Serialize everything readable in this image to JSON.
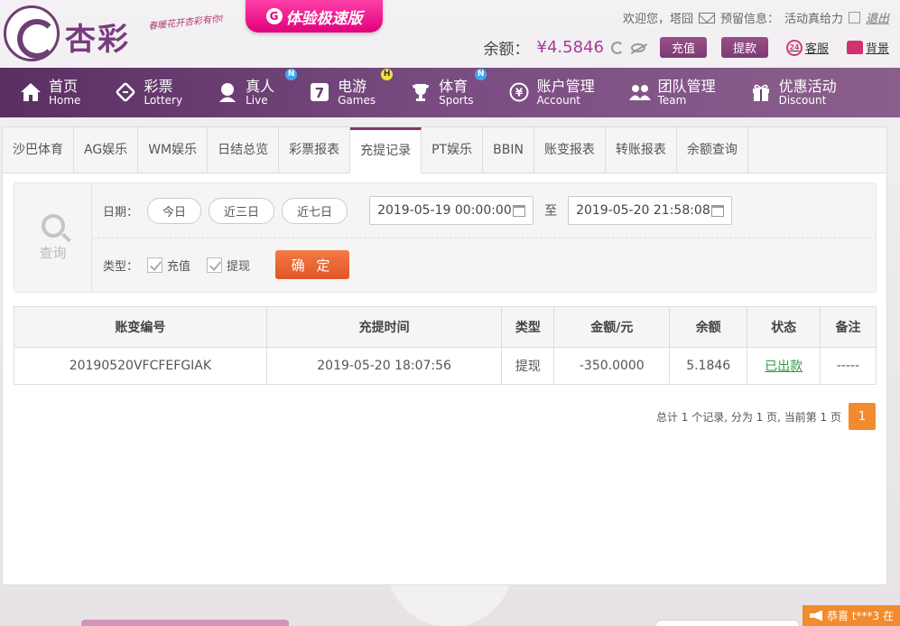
{
  "header": {
    "logo_name": "杏彩",
    "slogan": "春暖花开杏彩有你!",
    "speed_badge": "体验极速版",
    "welcome": "欢迎您，塔囧",
    "messages": "预留信息：",
    "activity": "活动真给力",
    "logout": "退出",
    "balance_label": "余额：",
    "balance_value": "¥4.5846",
    "deposit_btn": "充值",
    "withdraw_btn": "提款",
    "service": "客服",
    "service_badge": "24",
    "background": "背景"
  },
  "nav": {
    "items": [
      {
        "zh": "首页",
        "en": "Home",
        "icon": "home-icon",
        "badge": ""
      },
      {
        "zh": "彩票",
        "en": "Lottery",
        "icon": "ticket-icon",
        "badge": ""
      },
      {
        "zh": "真人",
        "en": "Live",
        "icon": "girl-icon",
        "badge": "N"
      },
      {
        "zh": "电游",
        "en": "Games",
        "icon": "seven-icon",
        "badge": "H"
      },
      {
        "zh": "体育",
        "en": "Sports",
        "icon": "trophy-icon",
        "badge": "N"
      },
      {
        "zh": "账户管理",
        "en": "Account",
        "icon": "yen-icon",
        "badge": ""
      },
      {
        "zh": "团队管理",
        "en": "Team",
        "icon": "team-icon",
        "badge": ""
      },
      {
        "zh": "优惠活动",
        "en": "Discount",
        "icon": "gift-icon",
        "badge": ""
      }
    ]
  },
  "tabs": [
    "沙巴体育",
    "AG娱乐",
    "WM娱乐",
    "日结总览",
    "彩票报表",
    "充提记录",
    "PT娱乐",
    "BBIN",
    "账变报表",
    "转账报表",
    "余额查询"
  ],
  "active_tab": "充提记录",
  "query": {
    "side_label": "查询",
    "date_label": "日期：",
    "quick": [
      "今日",
      "近三日",
      "近七日"
    ],
    "start": "2019-05-19 00:00:00",
    "to": "至",
    "end": "2019-05-20 21:58:08",
    "type_label": "类型：",
    "types": [
      "充值",
      "提现"
    ],
    "confirm": "确 定"
  },
  "table": {
    "headers": [
      "账变编号",
      "充提时间",
      "类型",
      "金额/元",
      "余额",
      "状态",
      "备注"
    ],
    "rows": [
      [
        "20190520VFCFEFGIAK",
        "2019-05-20 18:07:56",
        "提现",
        "-350.0000",
        "5.1846",
        "已出款",
        "-----"
      ]
    ]
  },
  "pager": {
    "summary": "总计 1 个记录, 分为 1 页, 当前第 1 页",
    "current": "1"
  },
  "notice": "恭喜 t***3 在",
  "colors": {
    "nav": "#6a3b72",
    "accent": "#f28b2d",
    "positive": "#2e9a3c",
    "brand": "#7a3b7e"
  }
}
